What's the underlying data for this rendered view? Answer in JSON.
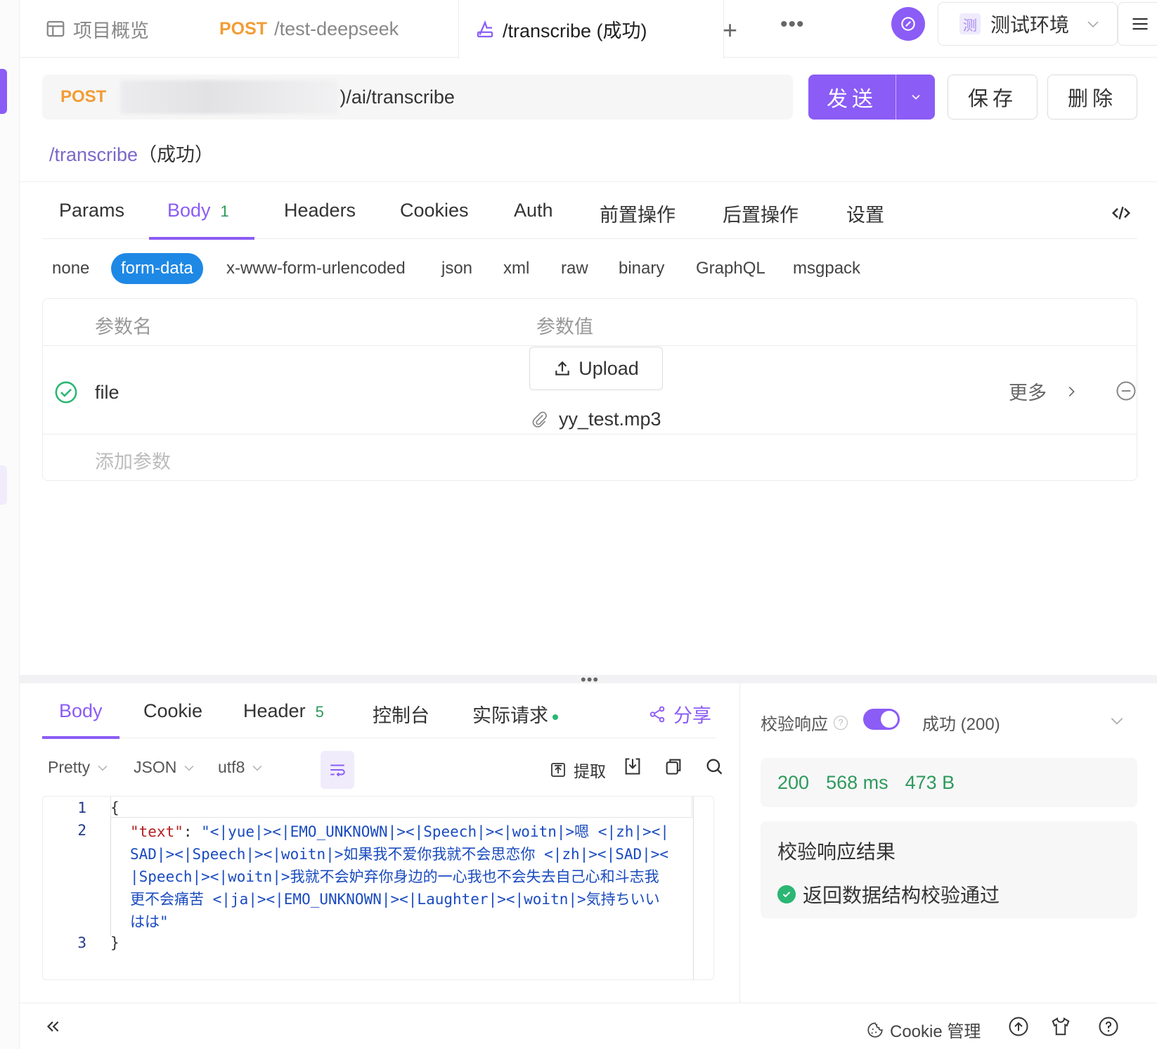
{
  "tabs": [
    {
      "label": "项目概览",
      "method": ""
    },
    {
      "label": "/test-deepseek",
      "method": "POST"
    },
    {
      "label": "/transcribe (成功)",
      "method": ""
    }
  ],
  "env": {
    "badge": "测",
    "name": "测试环境"
  },
  "request": {
    "method": "POST",
    "path": ")/ai/transcribe",
    "send_label": "发送",
    "save_label": "保存",
    "delete_label": "删除",
    "name_path": "/transcribe",
    "name_suffix": "（成功）"
  },
  "request_tabs": [
    {
      "label": "Params"
    },
    {
      "label": "Body",
      "count": "1"
    },
    {
      "label": "Headers"
    },
    {
      "label": "Cookies"
    },
    {
      "label": "Auth"
    },
    {
      "label": "前置操作"
    },
    {
      "label": "后置操作"
    },
    {
      "label": "设置"
    }
  ],
  "body_types": [
    "none",
    "form-data",
    "x-www-form-urlencoded",
    "json",
    "xml",
    "raw",
    "binary",
    "GraphQL",
    "msgpack"
  ],
  "params_table": {
    "header_name": "参数名",
    "header_value": "参数值",
    "rows": [
      {
        "name": "file",
        "upload_label": "Upload",
        "file_name": "yy_test.mp3",
        "more_label": "更多"
      }
    ],
    "add_placeholder": "添加参数"
  },
  "response_tabs": [
    {
      "label": "Body"
    },
    {
      "label": "Cookie"
    },
    {
      "label": "Header",
      "count": "5"
    },
    {
      "label": "控制台"
    },
    {
      "label": "实际请求"
    }
  ],
  "share_label": "分享",
  "format": {
    "mode": "Pretty",
    "type": "JSON",
    "encoding": "utf8",
    "extract_label": "提取"
  },
  "code": {
    "lines": [
      "1",
      "2",
      "3"
    ],
    "open": "{",
    "key": "\"text\"",
    "colon": ": ",
    "value": "\"<|yue|><|EMO_UNKNOWN|><|Speech|><|woitn|>嗯 <|zh|><|SAD|><|Speech|><|woitn|>如果我不爱你我就不会思恋你 <|zh|><|SAD|><|Speech|><|woitn|>我就不会妒弃你身边的一心我也不会失去自己心和斗志我更不会痛苦 <|ja|><|EMO_UNKNOWN|><|Laughter|><|woitn|>気持ちいいはは\"",
    "close": "}"
  },
  "validation": {
    "label": "校验响应",
    "status": "成功 (200)",
    "code": "200",
    "time": "568 ms",
    "size": "473 B",
    "result_title": "校验响应结果",
    "result_text": "返回数据结构校验通过"
  },
  "footer": {
    "cookie_label": "Cookie 管理"
  },
  "colors": {
    "accent": "#8b5cf6",
    "method": "#f39c34",
    "success": "#2e9a5c",
    "form_data": "#1e88e5"
  }
}
